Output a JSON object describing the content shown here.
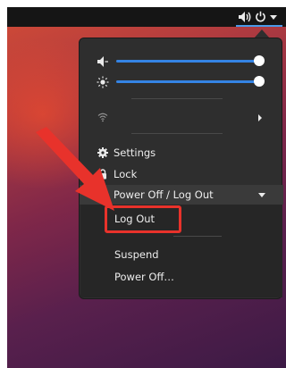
{
  "menu": {
    "settings_label": "Settings",
    "lock_label": "Lock",
    "power_label": "Power Off / Log Out",
    "submenu": {
      "logout_label": "Log Out",
      "suspend_label": "Suspend",
      "poweroff_label": "Power Off…"
    },
    "volume_level": 1.0,
    "brightness_level": 1.0
  },
  "colors": {
    "accent": "#3584e4",
    "annotation_red": "#e8322b",
    "menu_bg": "#2e2e2e",
    "topbar_bg": "#151515"
  },
  "icons": {
    "topbar": [
      "speaker-icon",
      "power-icon",
      "chevron-down-icon"
    ],
    "menu": [
      "volume-icon",
      "brightness-icon",
      "wifi-icon",
      "gear-icon",
      "lock-icon"
    ]
  }
}
